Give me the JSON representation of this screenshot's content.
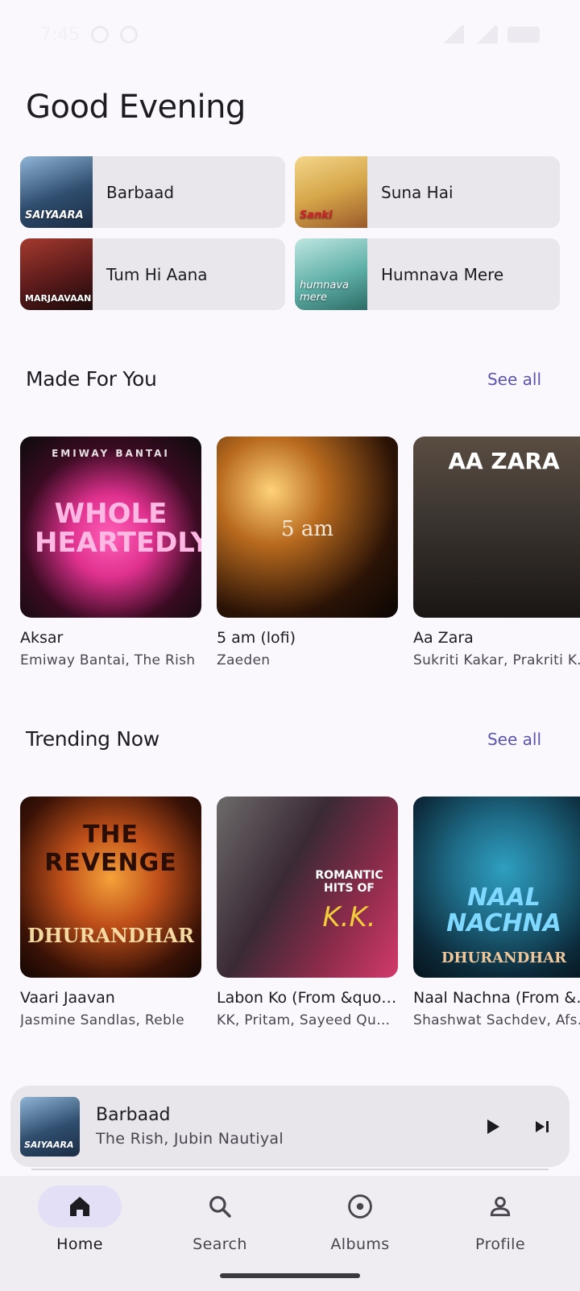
{
  "status_bar": {
    "time": "7:45"
  },
  "greeting": "Good Evening",
  "quick_picks": [
    {
      "title": "Barbaad",
      "thumb_tag": "SAIYAARA",
      "thumb_color": "#2f4d6e"
    },
    {
      "title": "Suna Hai",
      "thumb_tag": "Sanki",
      "thumb_color": "#d6a64a"
    },
    {
      "title": "Tum Hi Aana",
      "thumb_tag": "MARJAAVAAN",
      "thumb_color": "#5a1a1a"
    },
    {
      "title": "Humnava Mere",
      "thumb_tag": "humnava mere",
      "thumb_color": "#5fb0a8"
    }
  ],
  "made_for_you": {
    "title": "Made For You",
    "see_all": "See all",
    "items": [
      {
        "title": "Aksar",
        "subtitle": "Emiway Bantai, The Rish",
        "art_top": "EMIWAY BANTAI",
        "art_main": "WHOLE HEARTEDLY",
        "color": "#e0318f"
      },
      {
        "title": "5 am (lofi)",
        "subtitle": "Zaeden",
        "art_main": "5 am",
        "color": "#b86a1e"
      },
      {
        "title": "Aa Zara",
        "subtitle": "Sukriti Kakar, Prakriti Kakar",
        "art_main": "AA ZARA",
        "color": "#3b3530"
      }
    ]
  },
  "trending_now": {
    "title": "Trending Now",
    "see_all": "See all",
    "items": [
      {
        "title": "Vaari Jaavan",
        "subtitle": "Jasmine Sandlas, Reble",
        "art_top": "THE REVENGE",
        "art_main": "DHURANDHAR",
        "color": "#c0501a"
      },
      {
        "title": "Labon Ko (From &quot;Bhool Bhulaiyaa&quot;)",
        "subtitle": "KK, Pritam, Sayeed Quadri",
        "art_top": "ROMANTIC HITS OF",
        "art_main": "K.K.",
        "color": "#8a2b4a"
      },
      {
        "title": "Naal Nachna (From &quot;Dhurandhar&quot;)",
        "subtitle": "Shashwat Sachdev, Afsana Khan",
        "art_top": "NAAL NACHNA",
        "art_main": "DHURANDHAR",
        "color": "#1f6e8a"
      }
    ]
  },
  "now_playing": {
    "title": "Barbaad",
    "artists": "The Rish, Jubin Nautiyal",
    "thumb_tag": "SAIYAARA"
  },
  "nav": [
    {
      "label": "Home",
      "icon": "home-icon",
      "active": true
    },
    {
      "label": "Search",
      "icon": "search-icon",
      "active": false
    },
    {
      "label": "Albums",
      "icon": "album-icon",
      "active": false
    },
    {
      "label": "Profile",
      "icon": "profile-icon",
      "active": false
    }
  ]
}
